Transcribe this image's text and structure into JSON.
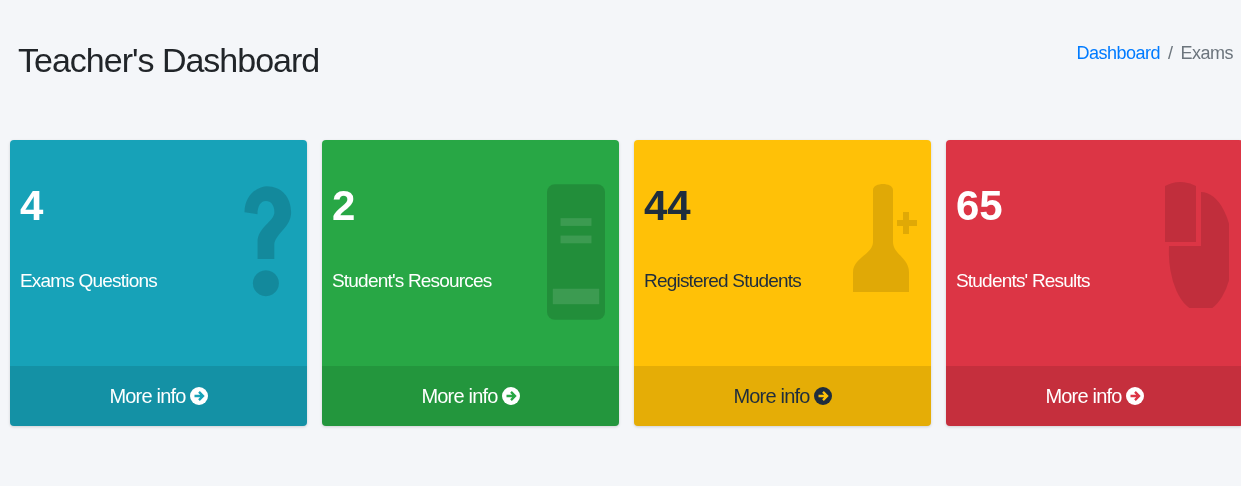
{
  "page_title": "Teacher's Dashboard",
  "breadcrumb": {
    "separator": "/",
    "items": [
      {
        "label": "Dashboard",
        "link": true
      },
      {
        "label": "Exams",
        "link": false
      }
    ]
  },
  "cards": [
    {
      "count": "4",
      "label": "Exams Questions",
      "link": "More info",
      "color": "#17a2b8"
    },
    {
      "count": "2",
      "label": "Student's Resources",
      "link": "More info",
      "color": "#28a745"
    },
    {
      "count": "44",
      "label": "Registered Students",
      "link": "More info",
      "color": "#ffc107"
    },
    {
      "count": "65",
      "label": "Students' Results",
      "link": "More info",
      "color": "#dc3545"
    }
  ]
}
